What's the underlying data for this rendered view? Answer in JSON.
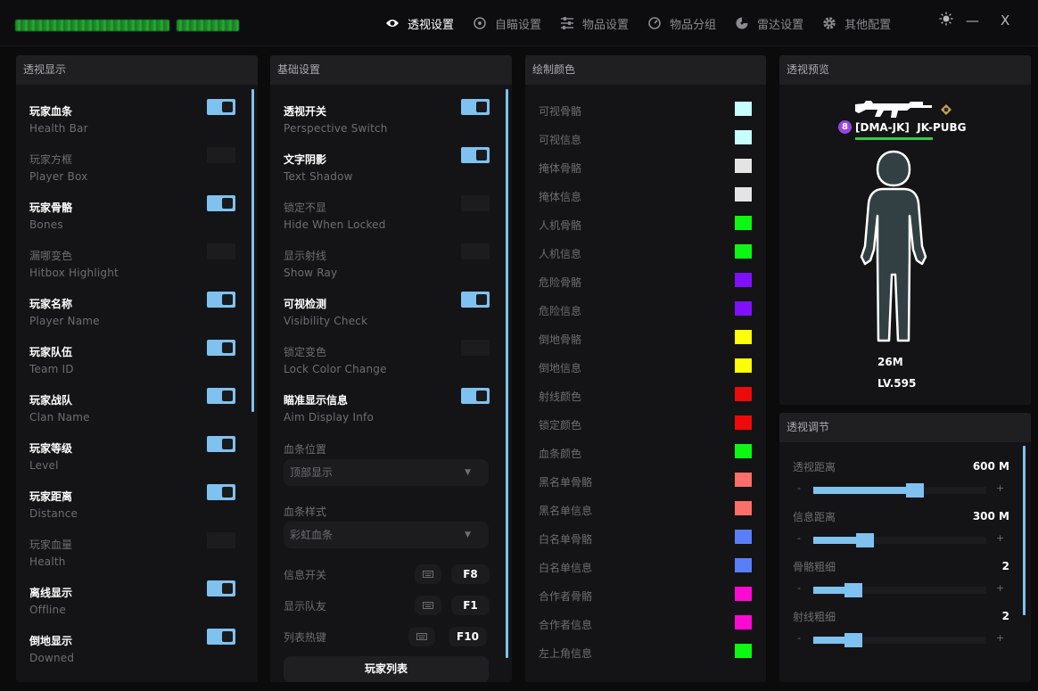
{
  "nav": [
    {
      "label": "透视设置",
      "icon": "eye-icon",
      "active": true
    },
    {
      "label": "自瞄设置",
      "icon": "crosshair-icon",
      "active": false
    },
    {
      "label": "物品设置",
      "icon": "sliders-icon",
      "active": false
    },
    {
      "label": "物品分组",
      "icon": "gauge-icon",
      "active": false
    },
    {
      "label": "雷达设置",
      "icon": "radar-icon",
      "active": false
    },
    {
      "label": "其他配置",
      "icon": "gear-icon",
      "active": false
    }
  ],
  "window": {
    "minimize": "—",
    "close": "X"
  },
  "esp_display": {
    "title": "透视显示",
    "items": [
      {
        "cn": "玩家血条",
        "en": "Health Bar",
        "on": true
      },
      {
        "cn": "玩家方框",
        "en": "Player Box",
        "on": false
      },
      {
        "cn": "玩家骨骼",
        "en": "Bones",
        "on": true
      },
      {
        "cn": "漏哪变色",
        "en": "Hitbox Highlight",
        "on": false
      },
      {
        "cn": "玩家名称",
        "en": "Player Name",
        "on": true
      },
      {
        "cn": "玩家队伍",
        "en": "Team ID",
        "on": true
      },
      {
        "cn": "玩家战队",
        "en": "Clan Name",
        "on": true
      },
      {
        "cn": "玩家等级",
        "en": "Level",
        "on": true
      },
      {
        "cn": "玩家距离",
        "en": "Distance",
        "on": true
      },
      {
        "cn": "玩家血量",
        "en": "Health",
        "on": false
      },
      {
        "cn": "离线显示",
        "en": "Offline",
        "on": true
      },
      {
        "cn": "倒地显示",
        "en": "Downed",
        "on": true
      }
    ]
  },
  "basic": {
    "title": "基础设置",
    "items": [
      {
        "cn": "透视开关",
        "en": "Perspective Switch",
        "on": true
      },
      {
        "cn": "文字阴影",
        "en": "Text Shadow",
        "on": true
      },
      {
        "cn": "锁定不显",
        "en": "Hide When Locked",
        "on": false
      },
      {
        "cn": "显示射线",
        "en": "Show Ray",
        "on": false
      },
      {
        "cn": "可视检测",
        "en": "Visibility Check",
        "on": true
      },
      {
        "cn": "锁定变色",
        "en": "Lock Color Change",
        "on": false
      },
      {
        "cn": "瞄准显示信息",
        "en": "Aim Display Info",
        "on": true
      }
    ],
    "health_pos_label": "血条位置",
    "health_pos_value": "顶部显示",
    "health_style_label": "血条样式",
    "health_style_value": "彩虹血条",
    "hotkeys": [
      {
        "label": "信息开关",
        "key": "F8"
      },
      {
        "label": "显示队友",
        "key": "F1"
      },
      {
        "label": "列表热键",
        "key": "F10"
      }
    ],
    "player_list_button": "玩家列表"
  },
  "colors": {
    "title": "绘制颜色",
    "items": [
      {
        "label": "可视骨骼",
        "color": "#c6fdfd"
      },
      {
        "label": "可视信息",
        "color": "#c6fdfd"
      },
      {
        "label": "掩体骨骼",
        "color": "#e4e4e4"
      },
      {
        "label": "掩体信息",
        "color": "#e4e4e4"
      },
      {
        "label": "人机骨骼",
        "color": "#0cf812"
      },
      {
        "label": "人机信息",
        "color": "#0cf812"
      },
      {
        "label": "危险骨骼",
        "color": "#8010fb"
      },
      {
        "label": "危险信息",
        "color": "#8010fb"
      },
      {
        "label": "倒地骨骼",
        "color": "#fefe06"
      },
      {
        "label": "倒地信息",
        "color": "#fefe06"
      },
      {
        "label": "射线颜色",
        "color": "#ee0a0a"
      },
      {
        "label": "锁定颜色",
        "color": "#ee0a0a"
      },
      {
        "label": "血条颜色",
        "color": "#0cf812"
      },
      {
        "label": "黑名单骨骼",
        "color": "#fc6e68"
      },
      {
        "label": "黑名单信息",
        "color": "#fc6e68"
      },
      {
        "label": "白名单骨骼",
        "color": "#5a7ef8"
      },
      {
        "label": "白名单信息",
        "color": "#5a7ef8"
      },
      {
        "label": "合作者骨骼",
        "color": "#fc0ad4"
      },
      {
        "label": "合作者信息",
        "color": "#fc0ad4"
      },
      {
        "label": "左上角信息",
        "color": "#0cf812"
      }
    ]
  },
  "preview": {
    "title": "透视预览",
    "level_badge": "8",
    "name": "[DMA-JK]  JK-PUBG",
    "distance": "26M",
    "level": "LV.595",
    "health_fraction": 1.0
  },
  "adjust": {
    "title": "透视调节",
    "items": [
      {
        "label": "透视距离",
        "value": "600 M",
        "fraction": 0.59
      },
      {
        "label": "信息距离",
        "value": "300 M",
        "fraction": 0.3
      },
      {
        "label": "骨骼粗细",
        "value": "2",
        "fraction": 0.23
      },
      {
        "label": "射线粗细",
        "value": "2",
        "fraction": 0.23
      }
    ],
    "minus": "-",
    "plus": "+"
  }
}
